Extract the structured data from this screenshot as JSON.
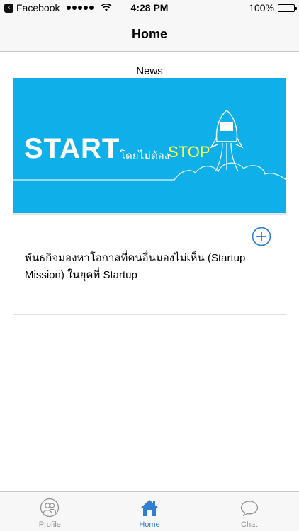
{
  "status_bar": {
    "back_app": "Facebook",
    "time": "4:28 PM",
    "battery": "100%",
    "battery_level": 1.0
  },
  "nav": {
    "title": "Home"
  },
  "section": {
    "title": "News"
  },
  "banner": {
    "headline": "START",
    "thai_text": "โดยไม่ต้อง",
    "stop_text": "STOP",
    "bg_color": "#0fb0ea",
    "accent_color": "#ffff4a"
  },
  "news_items": [
    {
      "text": "พันธกิจมองหาโอกาสที่คนอื่นมองไม่เห็น    (Startup Mission) ในยุคที่ Startup"
    }
  ],
  "tabs": [
    {
      "label": "Profile",
      "icon": "profile-icon",
      "active": false
    },
    {
      "label": "Home",
      "icon": "home-icon",
      "active": true
    },
    {
      "label": "Chat",
      "icon": "chat-bubble-icon",
      "active": false
    }
  ],
  "colors": {
    "accent": "#2f7fd3",
    "inactive": "#929292"
  }
}
